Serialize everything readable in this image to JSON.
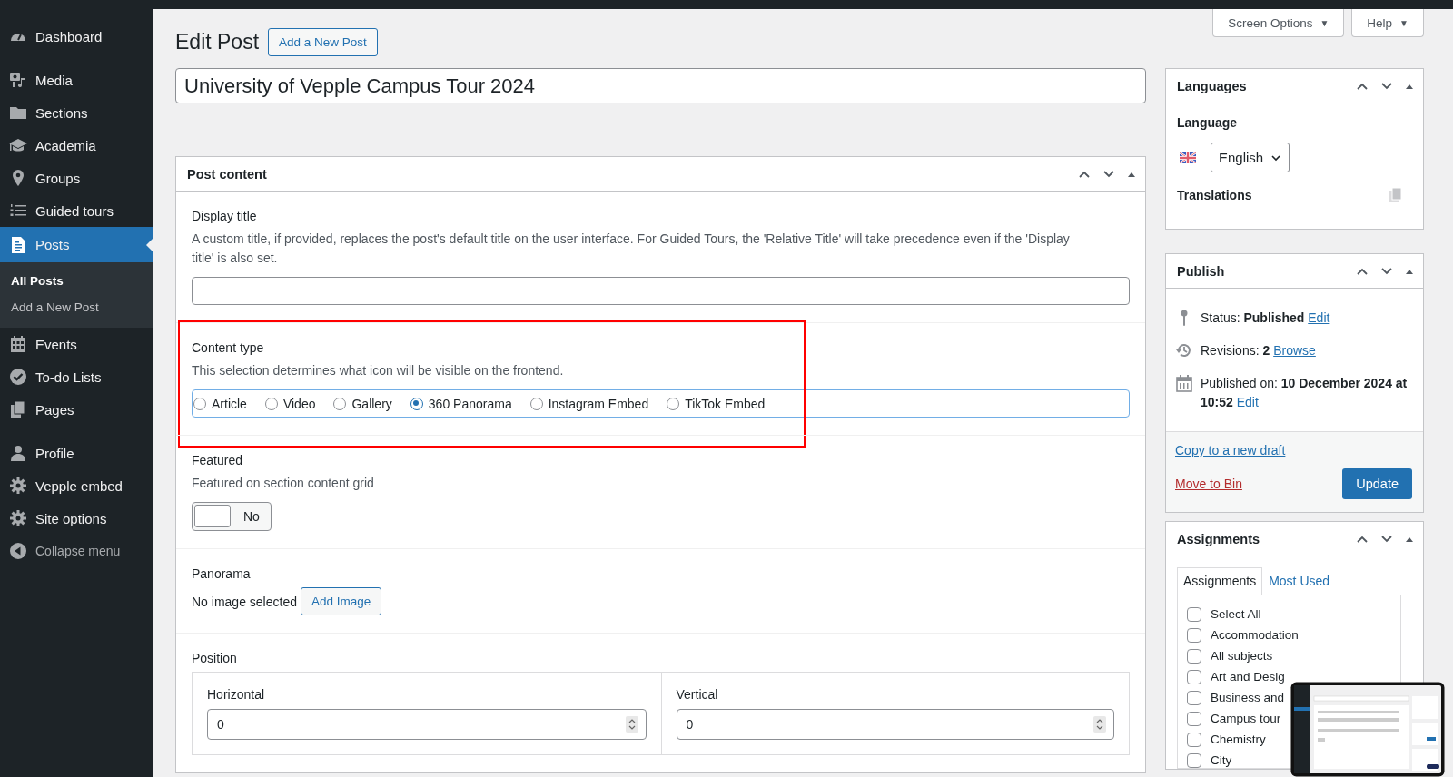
{
  "sidebar": {
    "groups": [
      {
        "items": [
          {
            "label": "Dashboard",
            "selected": false
          }
        ]
      },
      {
        "items": [
          {
            "label": "Media",
            "selected": false
          },
          {
            "label": "Sections",
            "selected": false
          },
          {
            "label": "Academia",
            "selected": false
          },
          {
            "label": "Groups",
            "selected": false
          },
          {
            "label": "Guided tours",
            "selected": false
          },
          {
            "label": "Posts",
            "selected": true,
            "children": [
              {
                "label": "All Posts",
                "selected": true
              },
              {
                "label": "Add a New Post",
                "selected": false
              }
            ]
          },
          {
            "label": "Events",
            "selected": false
          },
          {
            "label": "To-do Lists",
            "selected": false
          },
          {
            "label": "Pages",
            "selected": false
          }
        ]
      },
      {
        "items": [
          {
            "label": "Profile",
            "selected": false
          },
          {
            "label": "Vepple embed",
            "selected": false
          },
          {
            "label": "Site options",
            "selected": false
          }
        ]
      }
    ],
    "collapse": "Collapse menu"
  },
  "screen_tabs": [
    {
      "label": "Screen Options",
      "caret": "▼"
    },
    {
      "label": "Help",
      "caret": "▼"
    }
  ],
  "page_title": "Edit Post",
  "add_new_button": "Add a New Post",
  "post_title": "University of Vepple Campus Tour 2024",
  "post_content": {
    "title": "Post content",
    "fields": [
      {
        "kind": "text",
        "label": "Display title",
        "description": "A custom title, if provided, replaces the post's default title on the user interface. For Guided Tours, the 'Relative Title' will take precedence even if the 'Display title' is also set."
      },
      {
        "kind": "radio",
        "label": "Content type",
        "description": "This selection determines what icon will be visible on the frontend.",
        "highlighted": true,
        "options": [
          {
            "label": "Article",
            "selected": false
          },
          {
            "label": "Video",
            "selected": false
          },
          {
            "label": "Gallery",
            "selected": false
          },
          {
            "label": "360 Panorama",
            "selected": true
          },
          {
            "label": "Instagram Embed",
            "selected": false
          },
          {
            "label": "TikTok Embed",
            "selected": false
          }
        ]
      },
      {
        "kind": "toggle",
        "label": "Featured",
        "description": "Featured on section content grid",
        "on": false,
        "state_label": "No"
      },
      {
        "kind": "image",
        "label": "Panorama",
        "status": "No image selected",
        "button": "Add Image"
      },
      {
        "kind": "number_pair",
        "label": "Position",
        "items": [
          {
            "label": "Horizontal",
            "value": "0"
          },
          {
            "label": "Vertical",
            "value": "0"
          }
        ]
      }
    ]
  },
  "languages": {
    "title": "Languages",
    "language_label": "Language",
    "language": "English",
    "translations_label": "Translations"
  },
  "publish": {
    "title": "Publish",
    "rows": [
      {
        "label": "Status:",
        "value": "Published",
        "link": "Edit"
      },
      {
        "label": "Revisions:",
        "value": "2",
        "link": "Browse"
      },
      {
        "label": "Published on:",
        "value": "10 December 2024 at 10:52",
        "link": "Edit"
      }
    ],
    "copy_link": "Copy to a new draft",
    "trash_link": "Move to Bin",
    "update_button": "Update"
  },
  "assignments": {
    "title": "Assignments",
    "tabs": [
      {
        "label": "Assignments",
        "selected": true
      },
      {
        "label": "Most Used",
        "selected": false
      }
    ],
    "items": [
      {
        "label": "Select All",
        "checked": false
      },
      {
        "label": "Accommodation",
        "checked": false
      },
      {
        "label": "All subjects",
        "checked": false
      },
      {
        "label": "Art and Desig",
        "checked": false
      },
      {
        "label": "Business and",
        "checked": false
      },
      {
        "label": "Campus tour",
        "checked": false
      },
      {
        "label": "Chemistry",
        "checked": false
      },
      {
        "label": "City",
        "checked": false
      }
    ]
  },
  "overlay": {
    "kind": "thumbnail"
  }
}
